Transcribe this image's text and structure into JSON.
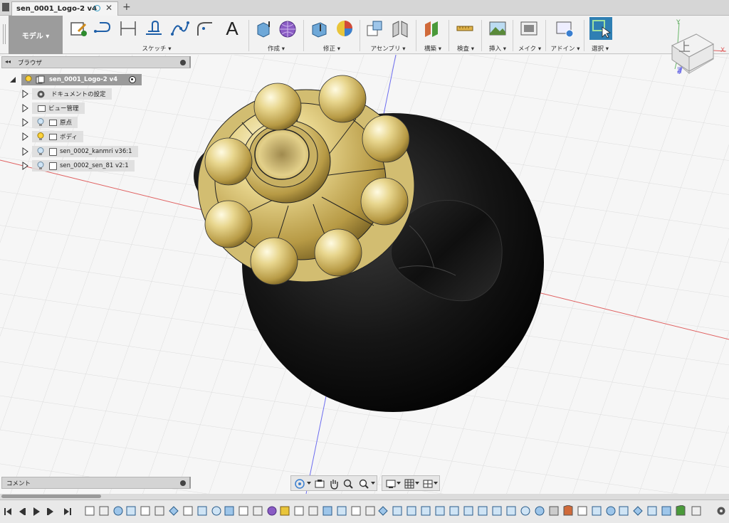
{
  "document": {
    "tab_title": "sen_0001_Logo-2 v4",
    "new_tab_symbol": "+",
    "close_symbol": "✕"
  },
  "toolbar": {
    "workspace_label": "モデル ▾",
    "groups": [
      {
        "id": "sketch",
        "label": "スケッチ ▾"
      },
      {
        "id": "create",
        "label": "作成 ▾"
      },
      {
        "id": "modify",
        "label": "修正 ▾"
      },
      {
        "id": "assemble",
        "label": "アセンブリ ▾"
      },
      {
        "id": "construct",
        "label": "構築 ▾"
      },
      {
        "id": "inspect",
        "label": "検査 ▾"
      },
      {
        "id": "insert",
        "label": "挿入 ▾"
      },
      {
        "id": "make",
        "label": "メイク ▾"
      },
      {
        "id": "addins",
        "label": "アドイン ▾"
      },
      {
        "id": "select",
        "label": "選択 ▾"
      }
    ],
    "text_tool_glyph": "A"
  },
  "browser": {
    "title": "ブラウザ",
    "collapse_glyph": "◂◂",
    "items": [
      {
        "label": "sen_0001_Logo-2 v4"
      },
      {
        "label": "ドキュメントの設定"
      },
      {
        "label": "ビュー管理"
      },
      {
        "label": "原点"
      },
      {
        "label": "ボディ"
      },
      {
        "label": "sen_0002_kanmri v36:1"
      },
      {
        "label": "sen_0002_sen_81 v2:1"
      }
    ]
  },
  "comment": {
    "title": "コメント"
  },
  "viewcube": {
    "face_label": "上",
    "axis_x": "X",
    "axis_y": "Y",
    "axis_z": "Z"
  },
  "colors": {
    "accent_blue": "#2f7fb3",
    "gold": "#c9b56a",
    "body_black": "#111111"
  }
}
